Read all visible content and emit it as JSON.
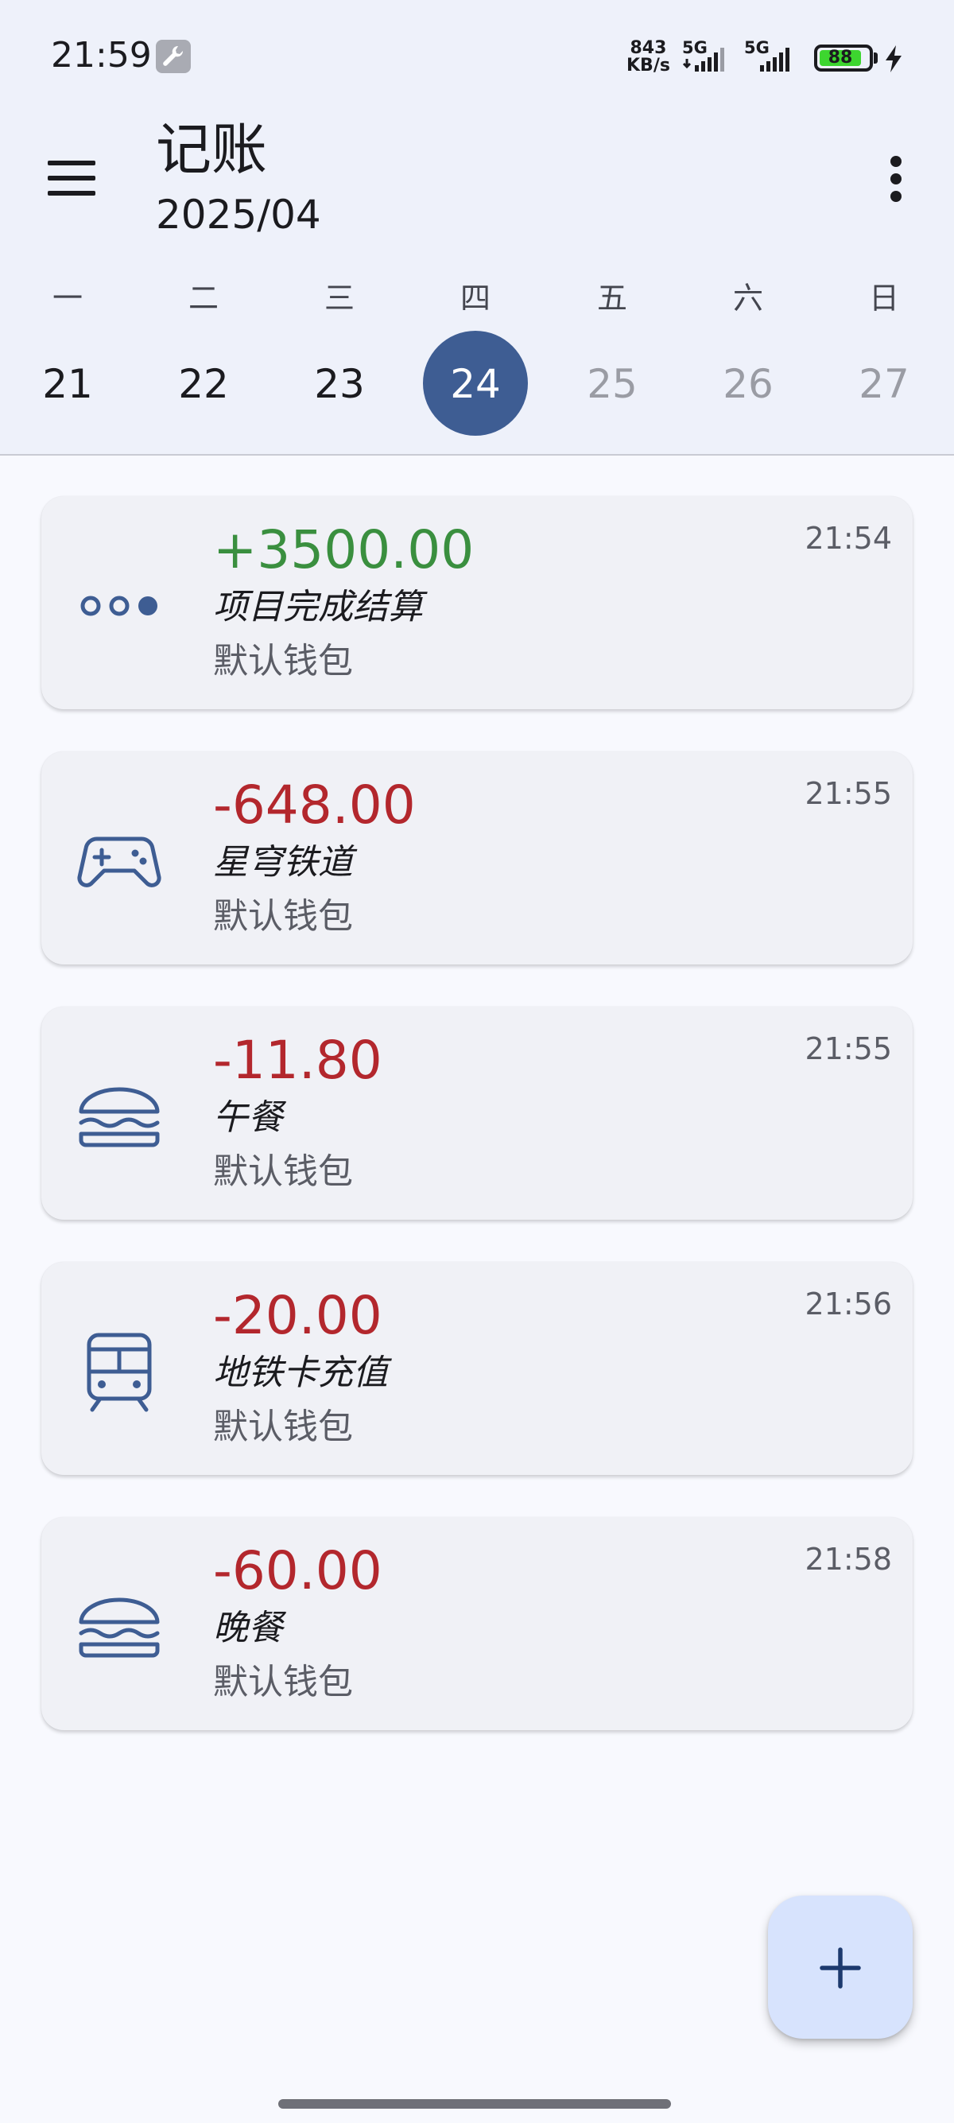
{
  "status_bar": {
    "time": "21:59",
    "net_speed_value": "843",
    "net_speed_unit": "KB/s",
    "signal1_label": "5G",
    "signal2_label": "5G",
    "battery": "88",
    "battery_level": 0.88,
    "tool_icon": "wrench-icon",
    "charging_icon": "lightning-icon"
  },
  "header": {
    "title": "记账",
    "subtitle": "2025/04",
    "menu_icon": "hamburger-menu-icon",
    "more_icon": "more-vert-icon"
  },
  "week": {
    "weekdays": [
      "一",
      "二",
      "三",
      "四",
      "五",
      "六",
      "日"
    ],
    "days": [
      "21",
      "22",
      "23",
      "24",
      "25",
      "26",
      "27"
    ],
    "selected_day": "24"
  },
  "transactions": [
    {
      "amount": "+3500.00",
      "note": "项目完成结算",
      "wallet": "默认钱包",
      "time": "21:54",
      "icon": "more-horiz-icon",
      "type": "income"
    },
    {
      "amount": "-648.00",
      "note": "星穹铁道",
      "wallet": "默认钱包",
      "time": "21:55",
      "icon": "gamepad-icon",
      "type": "expense"
    },
    {
      "amount": "-11.80",
      "note": "午餐",
      "wallet": "默认钱包",
      "time": "21:55",
      "icon": "burger-icon",
      "type": "expense"
    },
    {
      "amount": "-20.00",
      "note": "地铁卡充值",
      "wallet": "默认钱包",
      "time": "21:56",
      "icon": "subway-icon",
      "type": "expense"
    },
    {
      "amount": "-60.00",
      "note": "晚餐",
      "wallet": "默认钱包",
      "time": "21:58",
      "icon": "burger-icon",
      "type": "expense"
    }
  ],
  "fab": {
    "icon": "plus-icon"
  },
  "colors": {
    "accent": "#3e5d93",
    "income": "#3a8f3f",
    "expense": "#b3272d",
    "header_bg": "#eef1fa",
    "fab_bg": "#d7e3fd"
  }
}
